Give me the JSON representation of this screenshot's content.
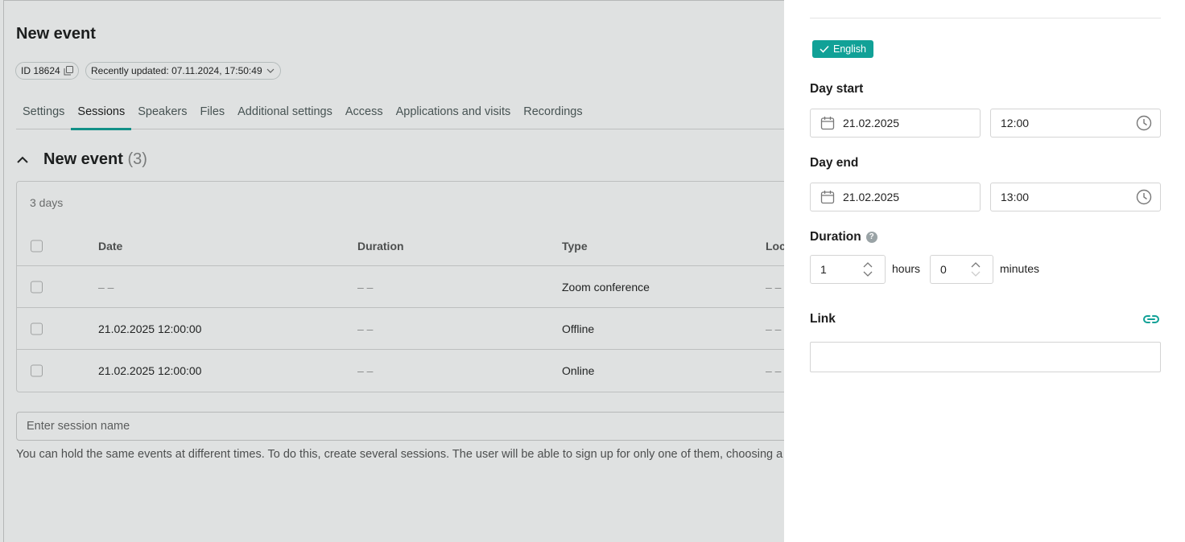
{
  "page": {
    "title": "New event",
    "id_chip": "ID 18624",
    "updated_chip": "Recently updated: 07.11.2024, 17:50:49",
    "tabs": [
      "Settings",
      "Sessions",
      "Speakers",
      "Files",
      "Additional settings",
      "Access",
      "Applications and visits",
      "Recordings"
    ],
    "active_tab": "Sessions",
    "section": {
      "title": "New event",
      "count": "(3)"
    },
    "table": {
      "summary": "3 days",
      "headers": {
        "date": "Date",
        "duration": "Duration",
        "type": "Type",
        "location": "Loca"
      },
      "rows": [
        {
          "date": "– –",
          "duration": "– –",
          "type": "Zoom conference",
          "location": "– –"
        },
        {
          "date": "21.02.2025 12:00:00",
          "duration": "– –",
          "type": "Offline",
          "location": "– –"
        },
        {
          "date": "21.02.2025 12:00:00",
          "duration": "– –",
          "type": "Online",
          "location": "– –"
        }
      ]
    },
    "session_placeholder": "Enter session name",
    "hint": "You can hold the same events at different times. To do this, create several sessions. The user will be able to sign up for only one of them, choosing a conve"
  },
  "panel": {
    "language_badge": "English",
    "day_start": {
      "label": "Day start",
      "date": "21.02.2025",
      "time": "12:00"
    },
    "day_end": {
      "label": "Day end",
      "date": "21.02.2025",
      "time": "13:00"
    },
    "duration": {
      "label": "Duration",
      "help": "?",
      "hours_value": "1",
      "hours_unit": "hours",
      "minutes_value": "0",
      "minutes_unit": "minutes"
    },
    "link": {
      "label": "Link",
      "value": ""
    }
  },
  "colors": {
    "accent": "#11a197",
    "overlay": "rgba(30,40,40,0.14)"
  }
}
